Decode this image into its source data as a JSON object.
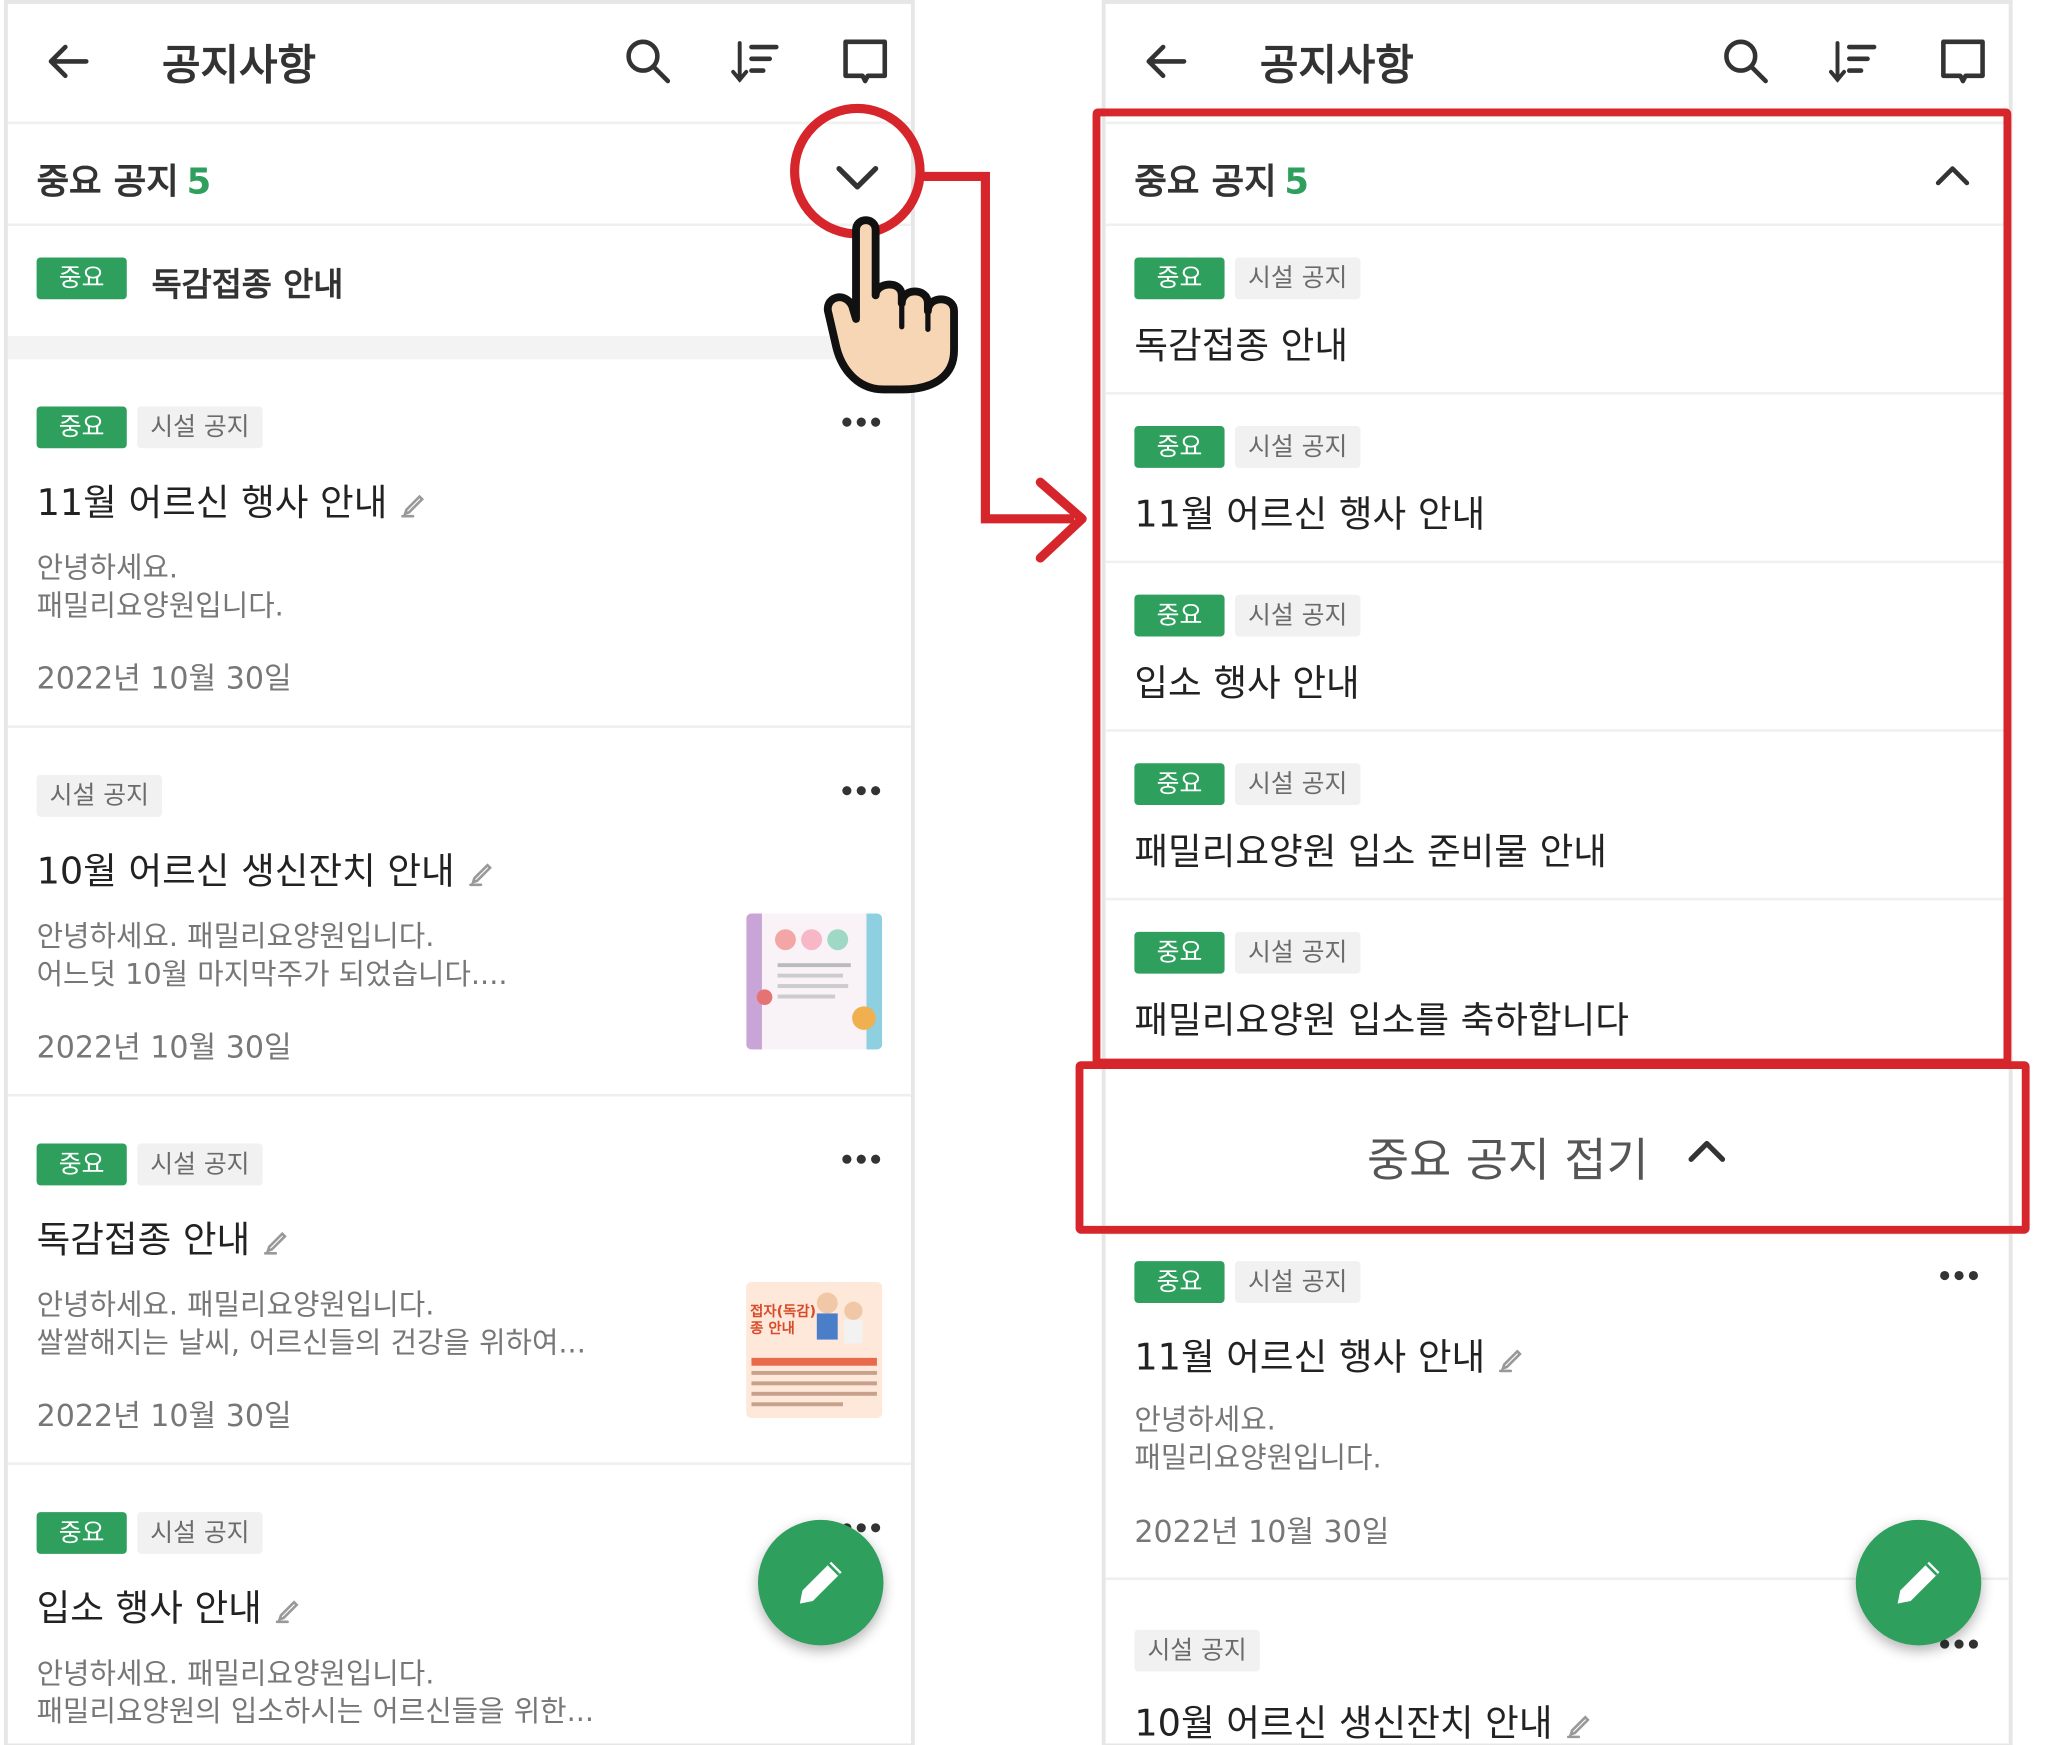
{
  "app": {
    "title": "공지사항",
    "icons": [
      "back-arrow-icon",
      "search-icon",
      "sort-icon",
      "book-icon"
    ]
  },
  "colors": {
    "accent": "#2e9f5d",
    "highlight": "#d6262c",
    "tag_bg": "#f1f1f1"
  },
  "important_section": {
    "label": "중요 공지",
    "count": "5",
    "collapsed_item": {
      "tag": "중요",
      "title": "독감접종 안내"
    },
    "expanded_items": [
      {
        "tag": "중요",
        "category": "시설 공지",
        "title": "독감접종 안내"
      },
      {
        "tag": "중요",
        "category": "시설 공지",
        "title": "11월 어르신 행사 안내"
      },
      {
        "tag": "중요",
        "category": "시설 공지",
        "title": "입소 행사 안내"
      },
      {
        "tag": "중요",
        "category": "시설 공지",
        "title": "패밀리요양원 입소 준비물 안내"
      },
      {
        "tag": "중요",
        "category": "시설 공지",
        "title": "패밀리요양원 입소를 축하합니다"
      }
    ],
    "fold_label": "중요 공지 접기"
  },
  "left_posts": [
    {
      "tag": "중요",
      "category": "시설 공지",
      "title": "11월 어르신 행사 안내",
      "body": "안녕하세요.\n패밀리요양원입니다.",
      "date": "2022년 10월 30일"
    },
    {
      "tag": "",
      "category": "시설 공지",
      "title": "10월 어르신 생신잔치 안내",
      "body": "안녕하세요. 패밀리요양원입니다.\n어느덧 10월 마지막주가 되었습니다....",
      "date": "2022년 10월 30일"
    },
    {
      "tag": "중요",
      "category": "시설 공지",
      "title": "독감접종 안내",
      "body": "안녕하세요. 패밀리요양원입니다.\n쌀쌀해지는 날씨, 어르신들의 건강을 위하여...",
      "date": "2022년 10월 30일"
    },
    {
      "tag": "중요",
      "category": "시설 공지",
      "title": "입소 행사 안내",
      "body": "안녕하세요. 패밀리요양원입니다.\n패밀리요양원의 입소하시는 어르신들을 위한...",
      "date": ""
    }
  ],
  "right_posts": [
    {
      "tag": "중요",
      "category": "시설 공지",
      "title": "11월 어르신 행사 안내",
      "body": "안녕하세요.\n패밀리요양원입니다.",
      "date": "2022년 10월 30일"
    },
    {
      "tag": "",
      "category": "시설 공지",
      "title": "10월 어르신 생신잔치 안내",
      "body": "",
      "date": ""
    }
  ],
  "thumb_texts": {
    "flu_title": "접자(독감)\n종 안내"
  }
}
